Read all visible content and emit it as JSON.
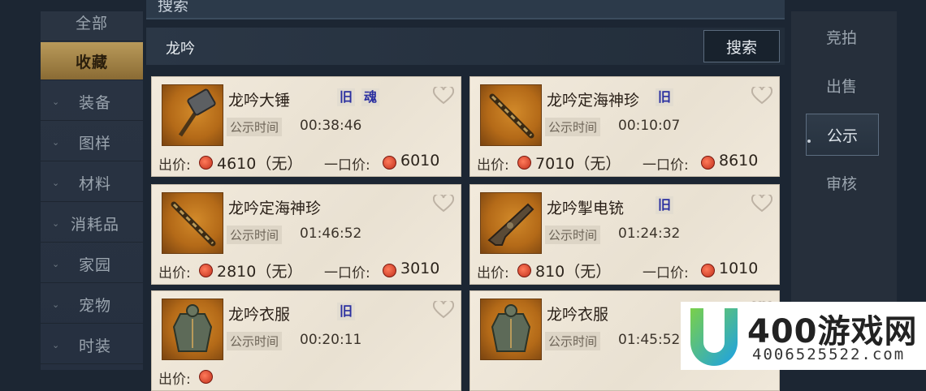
{
  "top_strip_label": "搜索",
  "sidebar": {
    "items": [
      {
        "label": "全部",
        "chevron": false,
        "active": false
      },
      {
        "label": "收藏",
        "chevron": false,
        "active": true
      },
      {
        "label": "装备",
        "chevron": true,
        "active": false
      },
      {
        "label": "图样",
        "chevron": true,
        "active": false
      },
      {
        "label": "材料",
        "chevron": true,
        "active": false
      },
      {
        "label": "消耗品",
        "chevron": true,
        "active": false
      },
      {
        "label": "家园",
        "chevron": true,
        "active": false
      },
      {
        "label": "宠物",
        "chevron": true,
        "active": false
      },
      {
        "label": "时装",
        "chevron": true,
        "active": false
      }
    ]
  },
  "search": {
    "query": "龙吟",
    "button_label": "搜索"
  },
  "cards": [
    {
      "name": "龙吟大锤",
      "tags": [
        "旧",
        "魂"
      ],
      "time_label": "公示时间",
      "time": "00:38:46",
      "price_label": "出价:",
      "price": "4610（无）",
      "buyout_label": "一口价:",
      "buyout": "6010",
      "icon": "hammer-icon"
    },
    {
      "name": "龙吟定海神珍",
      "tags": [
        "旧"
      ],
      "time_label": "公示时间",
      "time": "00:10:07",
      "price_label": "出价:",
      "price": "7010（无）",
      "buyout_label": "一口价:",
      "buyout": "8610",
      "icon": "staff-icon"
    },
    {
      "name": "龙吟定海神珍",
      "tags": [],
      "time_label": "公示时间",
      "time": "01:46:52",
      "price_label": "出价:",
      "price": "2810（无）",
      "buyout_label": "一口价:",
      "buyout": "3010",
      "icon": "staff-icon"
    },
    {
      "name": "龙吟掣电铳",
      "tags": [
        "旧"
      ],
      "time_label": "公示时间",
      "time": "01:24:32",
      "price_label": "出价:",
      "price": "810（无）",
      "buyout_label": "一口价:",
      "buyout": "1010",
      "icon": "gun-icon"
    },
    {
      "name": "龙吟衣服",
      "tags": [
        "旧"
      ],
      "time_label": "公示时间",
      "time": "00:20:11",
      "price_label": "出价:",
      "price": "",
      "buyout_label": "",
      "buyout": "",
      "icon": "armor-icon"
    },
    {
      "name": "龙吟衣服",
      "tags": [],
      "time_label": "公示时间",
      "time": "01:45:52",
      "price_label": "",
      "price": "",
      "buyout_label": "",
      "buyout": "",
      "icon": "armor-icon"
    }
  ],
  "right_tabs": [
    {
      "label": "竞拍",
      "active": false
    },
    {
      "label": "出售",
      "active": false
    },
    {
      "label": "公示",
      "active": true
    },
    {
      "label": "审核",
      "active": false
    }
  ],
  "watermark": {
    "title": "400游戏网",
    "subtitle": "4006525522.com"
  }
}
